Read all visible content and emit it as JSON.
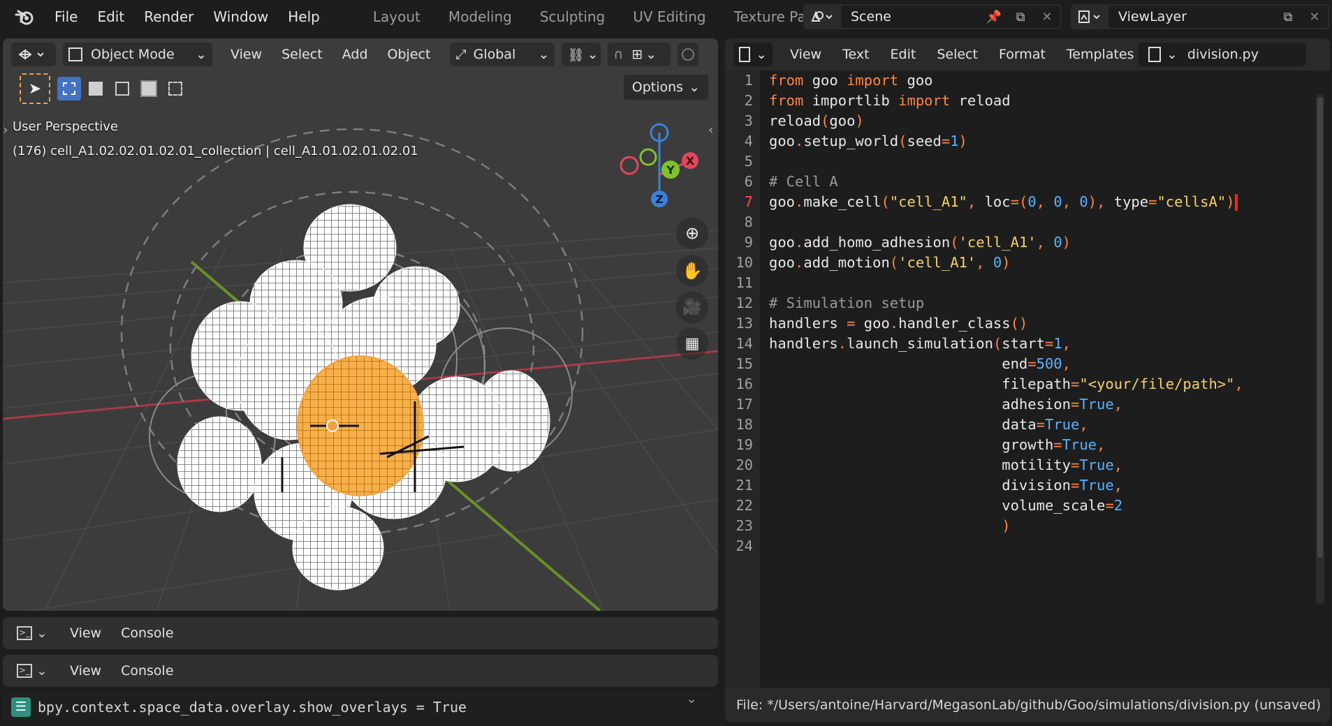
{
  "topbar": {
    "menus": [
      "File",
      "Edit",
      "Render",
      "Window",
      "Help"
    ],
    "workspace_tabs": [
      "Layout",
      "Modeling",
      "Sculpting",
      "UV Editing",
      "Texture Paint"
    ],
    "scene_name": "Scene",
    "view_layer_name": "ViewLayer"
  },
  "viewport": {
    "mode": "Object Mode",
    "menus": [
      "View",
      "Select",
      "Add",
      "Object"
    ],
    "transform_orientation": "Global",
    "options_label": "Options",
    "view_name": "User Perspective",
    "selection_info": "(176) cell_A1.02.02.01.02.01_collection | cell_A1.01.02.01.02.01",
    "gizmo_axes": {
      "x": "X",
      "y": "Y",
      "z": "Z"
    },
    "colors": {
      "x_axis": "#e0475c",
      "y_axis": "#7fc22d",
      "z_axis": "#3b82d6",
      "selected": "#f5a142",
      "background": "#3c3c3c"
    }
  },
  "consoles": [
    {
      "menus": [
        "View",
        "Console"
      ]
    },
    {
      "menus": [
        "View",
        "Console"
      ]
    }
  ],
  "console_output": "bpy.context.space_data.overlay.show_overlays = True",
  "editor": {
    "menus": [
      "View",
      "Text",
      "Edit",
      "Select",
      "Format",
      "Templates"
    ],
    "file_name": "division.py",
    "active_line": 7,
    "line_numbers": [
      "1",
      "2",
      "3",
      "4",
      "5",
      "6",
      "7",
      "8",
      "9",
      "10",
      "11",
      "12",
      "13",
      "14",
      "15",
      "16",
      "17",
      "18",
      "19",
      "20",
      "21",
      "22",
      "23",
      "24"
    ],
    "code_lines": [
      "from goo import goo",
      "from importlib import reload",
      "reload(goo)",
      "goo.setup_world(seed=1)",
      "",
      "# Cell A",
      "goo.make_cell(\"cell_A1\", loc=(0, 0, 0), type=\"cellsA\")",
      "",
      "goo.add_homo_adhesion('cell_A1', 0)",
      "goo.add_motion('cell_A1', 0)",
      "",
      "# Simulation setup",
      "handlers = goo.handler_class()",
      "handlers.launch_simulation(start=1,",
      "                           end=500,",
      "                           filepath=\"<your/file/path>\",",
      "                           adhesion=True,",
      "                           data=True,",
      "                           growth=True,",
      "                           motility=True,",
      "                           division=True,",
      "                           volume_scale=2",
      "                           )",
      ""
    ],
    "status": "File: */Users/antoine/Harvard/MegasonLab/github/Goo/simulations/division.py (unsaved)"
  }
}
